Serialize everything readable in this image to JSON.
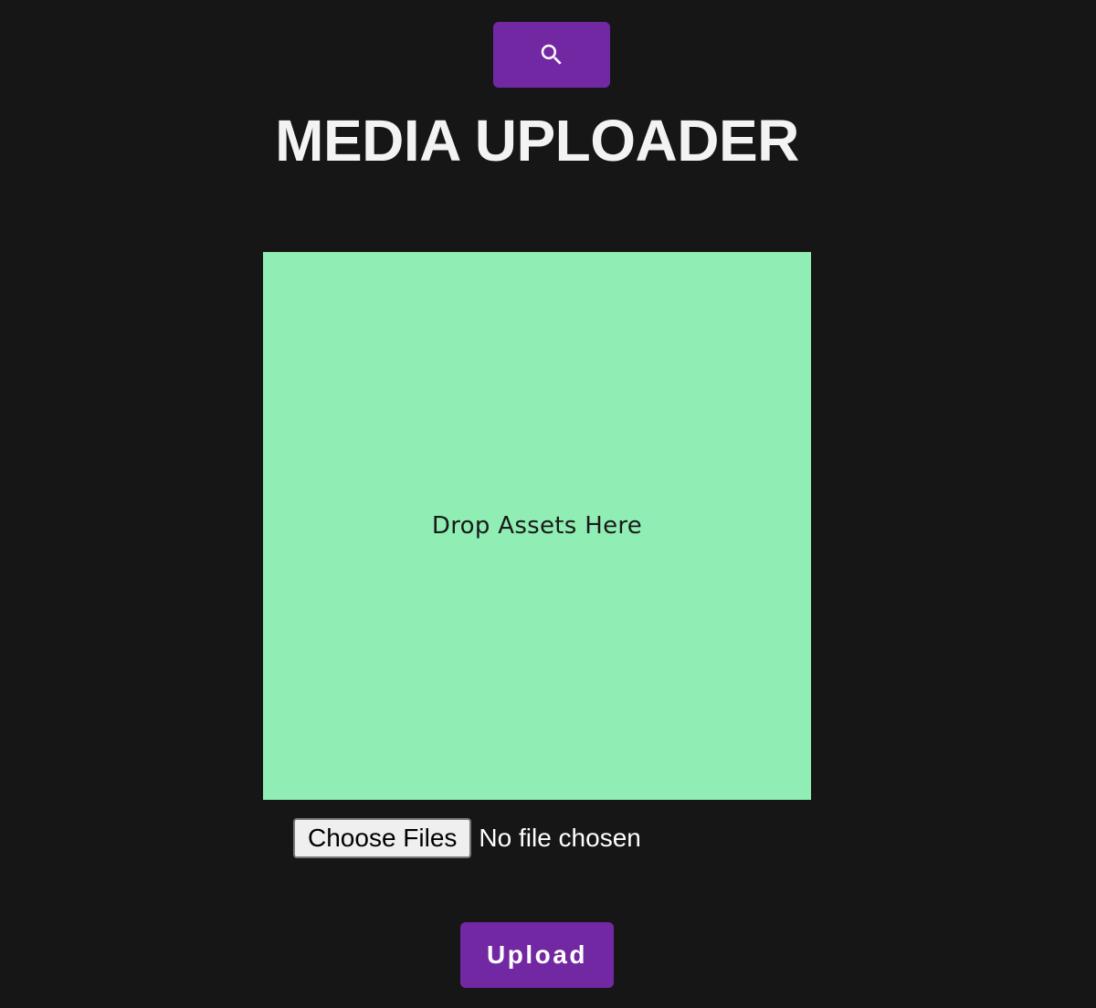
{
  "header": {
    "search_icon": "search-icon",
    "title": "MEDIA UPLOADER"
  },
  "dropzone": {
    "label": "Drop Assets Here"
  },
  "file_input": {
    "button_label": "Choose Files",
    "status": "No file chosen"
  },
  "actions": {
    "upload_label": "Upload"
  },
  "colors": {
    "background": "#161616",
    "accent": "#7328a3",
    "dropzone": "#90eeb4",
    "title_text": "#f3f3f3"
  }
}
